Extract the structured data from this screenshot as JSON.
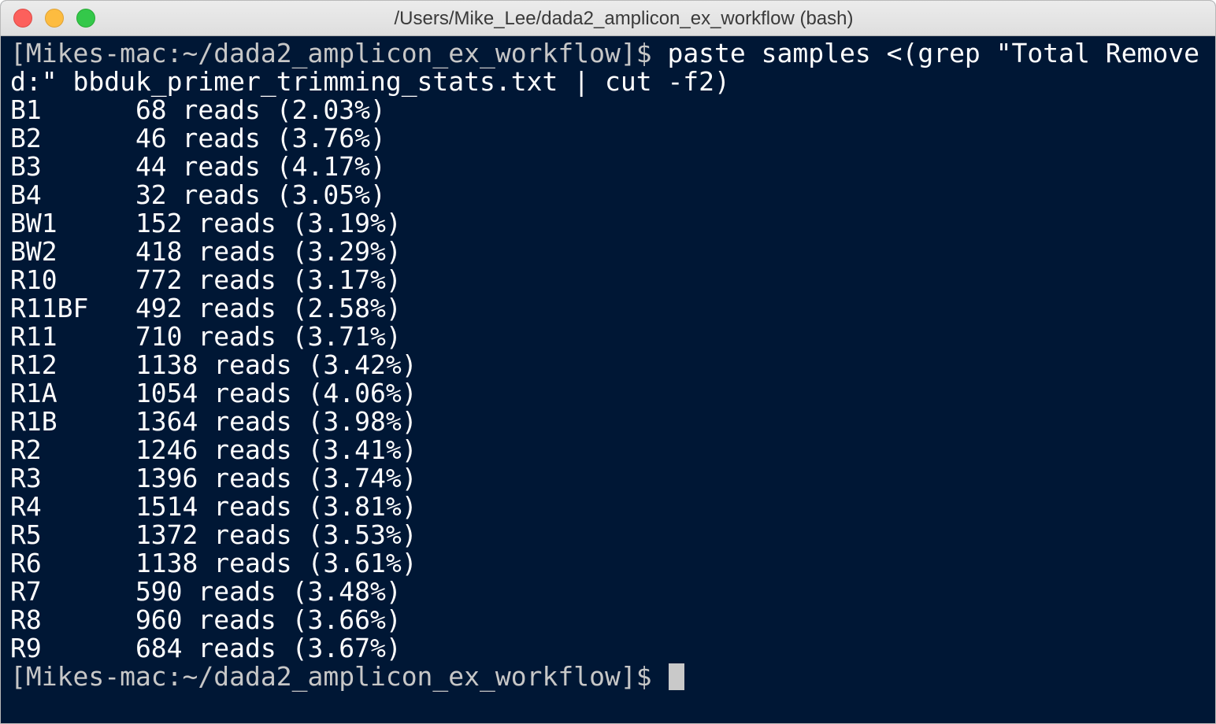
{
  "window": {
    "title": "/Users/Mike_Lee/dada2_amplicon_ex_workflow (bash)"
  },
  "terminal": {
    "prompt": "[Mikes-mac:~/dada2_amplicon_ex_workflow]$",
    "command_line1": " paste samples <(grep \"Total Remove",
    "command_line2": "d:\" bbduk_primer_trimming_stats.txt | cut -f2)",
    "output_lines": [
      "B1      68 reads (2.03%)",
      "B2      46 reads (3.76%)",
      "B3      44 reads (4.17%)",
      "B4      32 reads (3.05%)",
      "BW1     152 reads (3.19%)",
      "BW2     418 reads (3.29%)",
      "R10     772 reads (3.17%)",
      "R11BF   492 reads (2.58%)",
      "R11     710 reads (3.71%)",
      "R12     1138 reads (3.42%)",
      "R1A     1054 reads (4.06%)",
      "R1B     1364 reads (3.98%)",
      "R2      1246 reads (3.41%)",
      "R3      1396 reads (3.74%)",
      "R4      1514 reads (3.81%)",
      "R5      1372 reads (3.53%)",
      "R6      1138 reads (3.61%)",
      "R7      590 reads (3.48%)",
      "R8      960 reads (3.66%)",
      "R9      684 reads (3.67%)"
    ],
    "final_prompt": "[Mikes-mac:~/dada2_amplicon_ex_workflow]$"
  },
  "colors": {
    "terminal_background": "#001735",
    "terminal_text": "#ffffff",
    "prompt_text": "#c7c7c7",
    "cursor": "#c9c9c9"
  }
}
